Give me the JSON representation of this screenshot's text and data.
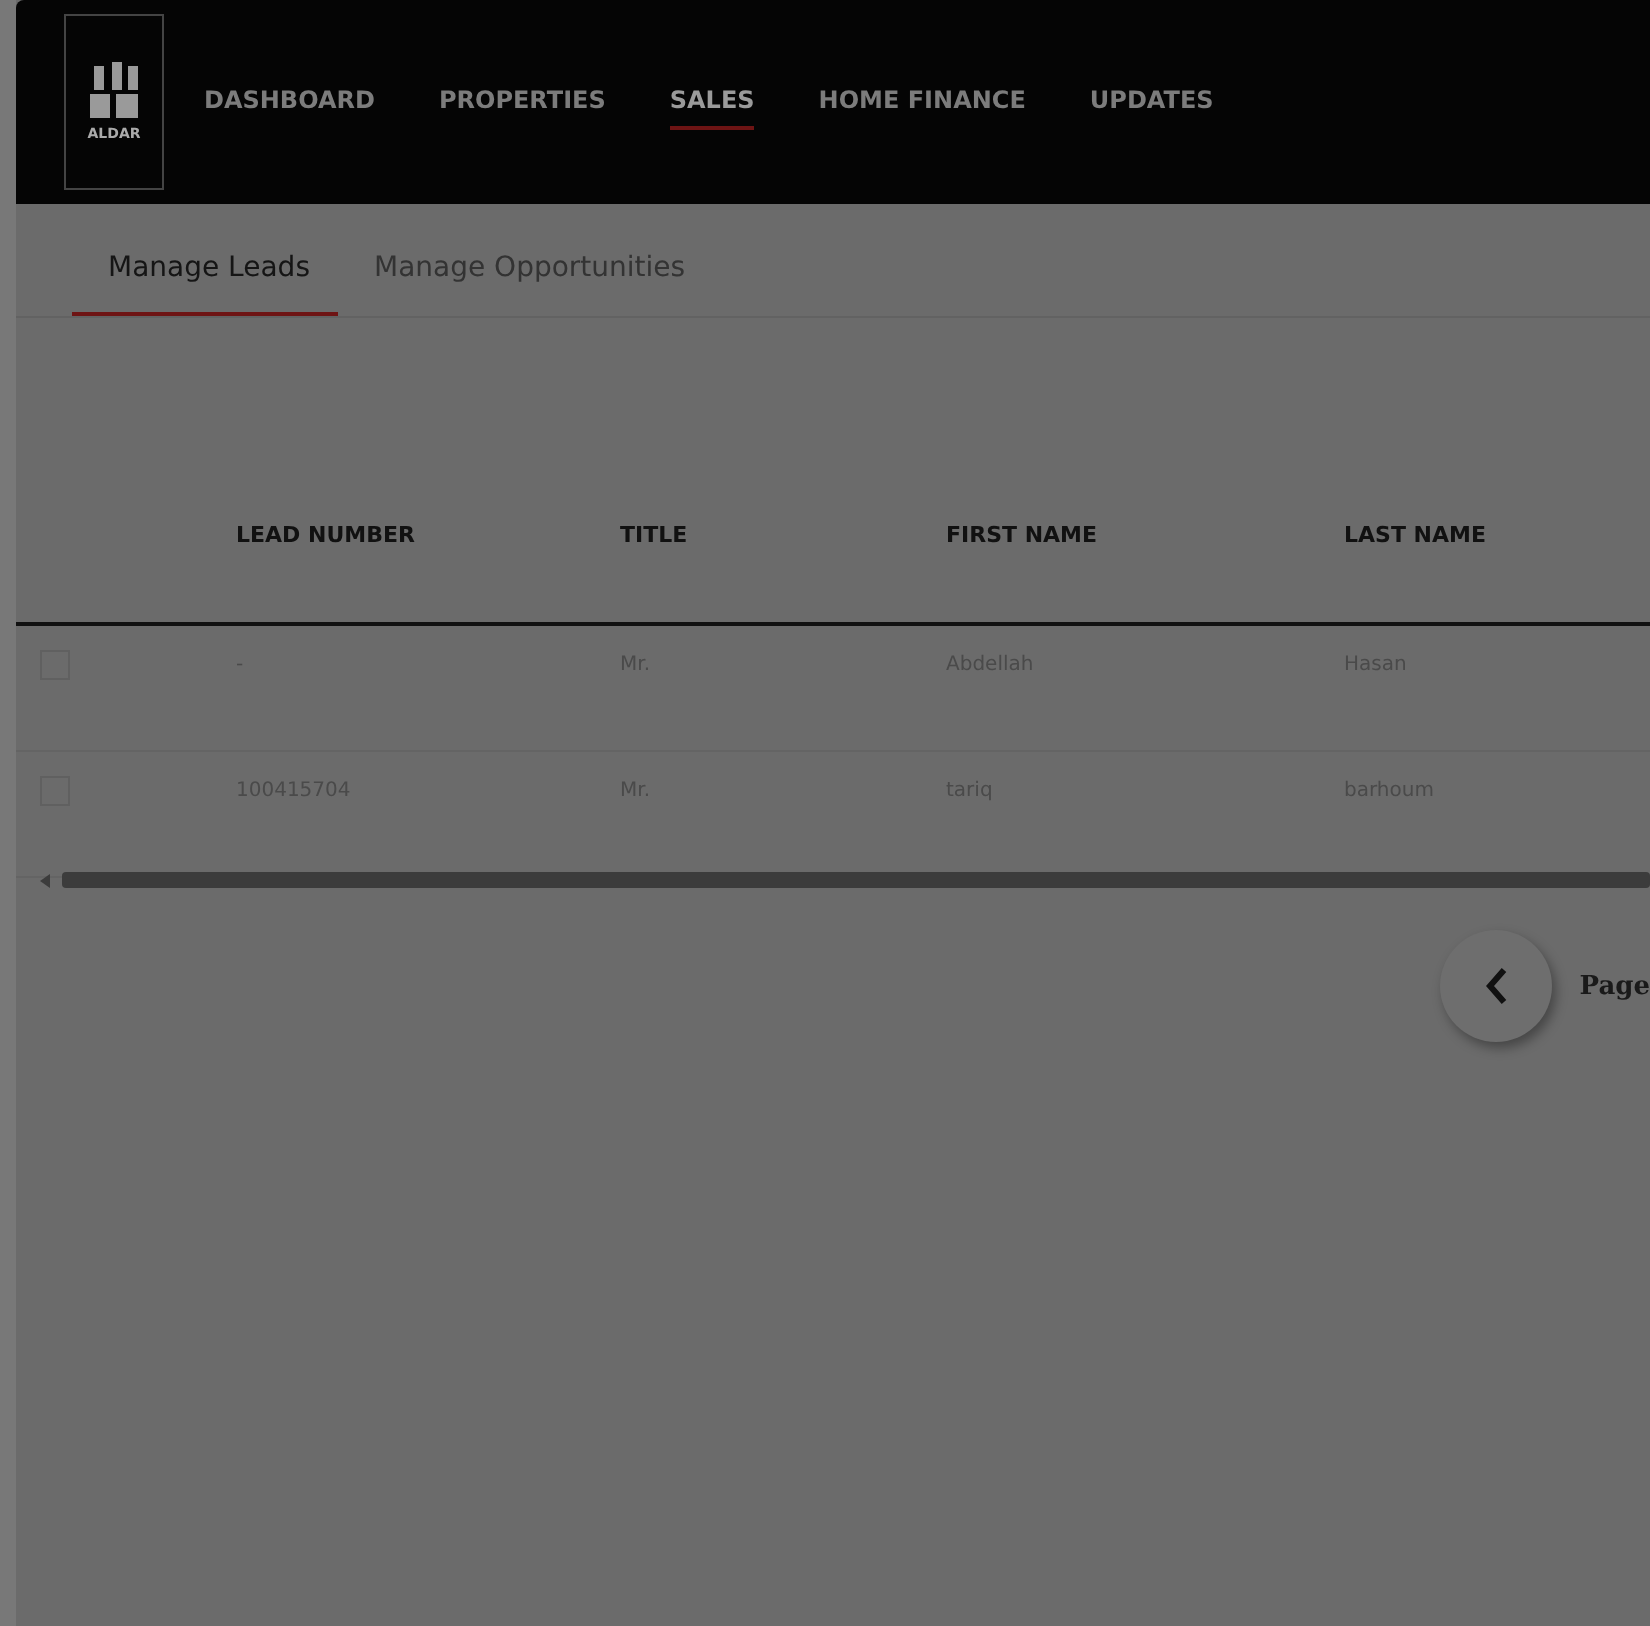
{
  "header": {
    "logo_text": "ALDAR",
    "nav": [
      {
        "label": "DASHBOARD",
        "selected": false
      },
      {
        "label": "PROPERTIES",
        "selected": false
      },
      {
        "label": "SALES",
        "selected": true
      },
      {
        "label": "HOME FINANCE",
        "selected": false
      },
      {
        "label": "UPDATES",
        "selected": false
      }
    ]
  },
  "subtabs": [
    {
      "label": "Manage Leads",
      "selected": true
    },
    {
      "label": "Manage Opportunities",
      "selected": false
    }
  ],
  "table": {
    "columns": [
      "LEAD NUMBER",
      "TITLE",
      "FIRST NAME",
      "LAST NAME"
    ],
    "rows": [
      {
        "checked": false,
        "cells": [
          "-",
          "Mr.",
          "Abdellah",
          "Hasan"
        ]
      },
      {
        "checked": false,
        "cells": [
          "100415704",
          "Mr.",
          "tariq",
          "barhoum"
        ]
      }
    ]
  },
  "pager": {
    "label": "Page"
  }
}
